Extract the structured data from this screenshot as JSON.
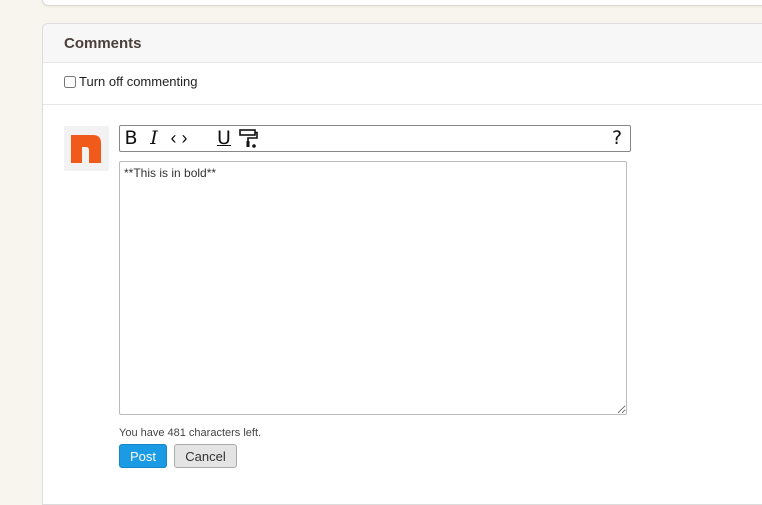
{
  "comments": {
    "title": "Comments",
    "turn_off_label": "Turn off commenting",
    "turn_off_checked": false
  },
  "editor": {
    "toolbar": {
      "bold_label": "B",
      "italic_label": "I",
      "code_label": "‹ ›",
      "underline_label": "U",
      "help_label": "?"
    },
    "text": "**This is in bold**",
    "chars_left": "You have 481 characters left."
  },
  "actions": {
    "post_label": "Post",
    "cancel_label": "Cancel"
  },
  "colors": {
    "avatar_accent": "#f05a1a",
    "post_button": "#1a9be3"
  },
  "icons": {
    "avatar": "user-avatar-icon",
    "paint": "paint-roller-icon"
  }
}
